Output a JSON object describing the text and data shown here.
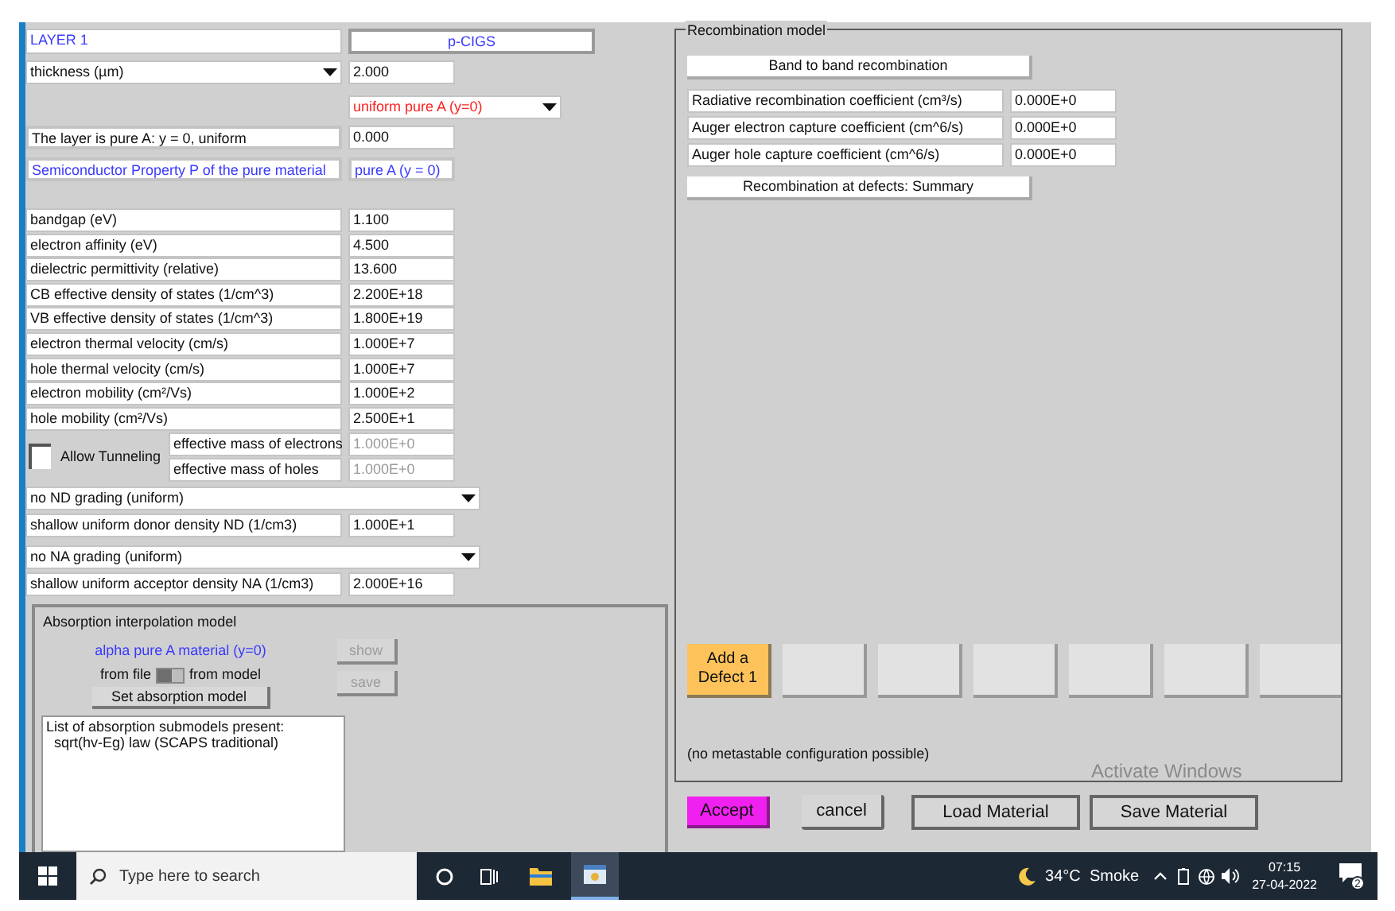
{
  "layer": {
    "title": "LAYER 1",
    "name": "p-CIGS"
  },
  "thickness": {
    "label": "thickness (µm)",
    "value": "2.000"
  },
  "grading": "uniform pure A (y=0)",
  "composition": {
    "label": "The layer is pure A: y = 0, uniform",
    "value": "0.000"
  },
  "property": {
    "label": "Semiconductor Property P of the pure material",
    "value": "pure A (y = 0)"
  },
  "parameters": [
    {
      "label": "bandgap (eV)",
      "value": "1.100"
    },
    {
      "label": "electron affinity (eV)",
      "value": "4.500"
    },
    {
      "label": "dielectric permittivity (relative)",
      "value": "13.600"
    },
    {
      "label": "CB effective density of states (1/cm^3)",
      "value": "2.200E+18"
    },
    {
      "label": "VB effective density of states (1/cm^3)",
      "value": "1.800E+19"
    },
    {
      "label": "electron thermal velocity (cm/s)",
      "value": "1.000E+7"
    },
    {
      "label": "hole thermal velocity (cm/s)",
      "value": "1.000E+7"
    },
    {
      "label": "electron mobility (cm²/Vs)",
      "value": "1.000E+2"
    },
    {
      "label": "hole mobility (cm²/Vs)",
      "value": "2.500E+1"
    }
  ],
  "tunneling": {
    "label": "Allow Tunneling",
    "checked": false,
    "rows": [
      {
        "label": "effective mass of electrons",
        "value": "1.000E+0",
        "disabled": true
      },
      {
        "label": "effective mass of holes",
        "value": "1.000E+0",
        "disabled": true
      }
    ]
  },
  "doping": [
    {
      "grading": "no ND grading (uniform)",
      "label": "shallow uniform donor density ND (1/cm3)",
      "value": "1.000E+1"
    },
    {
      "grading": "no NA grading (uniform)",
      "label": "shallow uniform acceptor density NA (1/cm3)",
      "value": "2.000E+16"
    }
  ],
  "absorption": {
    "title": "Absorption interpolation model",
    "material": "alpha pure A material (y=0)",
    "from_file": "from file",
    "from_model": "from model",
    "toggle_on": false,
    "set_button": "Set absorption model",
    "side_buttons": [
      {
        "label": "show",
        "disabled": true
      },
      {
        "label": "save",
        "disabled": true
      }
    ],
    "list_lines": [
      "List of absorption submodels present:",
      "  sqrt(hv-Eg) law (SCAPS traditional)"
    ]
  },
  "recombination": {
    "title": "Recombination model",
    "band_button": "Band to band recombination",
    "rows": [
      {
        "label": "Radiative recombination coefficient (cm³/s)",
        "value": "0.000E+0"
      },
      {
        "label": "Auger electron capture coefficient (cm^6/s)",
        "value": "0.000E+0"
      },
      {
        "label": "Auger hole capture coefficient (cm^6/s)",
        "value": "0.000E+0"
      }
    ],
    "defects_button": "Recombination at defects: Summary",
    "defect_slots": [
      {
        "kind": "add",
        "label": "Add a Defect 1"
      },
      {
        "kind": "empty"
      },
      {
        "kind": "empty"
      },
      {
        "kind": "empty"
      },
      {
        "kind": "empty"
      },
      {
        "kind": "empty"
      },
      {
        "kind": "empty"
      }
    ],
    "note": "(no metastable configuration possible)"
  },
  "activation_notice": "Activate Windows",
  "buttons": [
    {
      "kind": "accept",
      "label": "Accept"
    },
    {
      "kind": "plain",
      "label": "cancel"
    },
    {
      "kind": "wide",
      "label": "Load Material"
    },
    {
      "kind": "wide",
      "label": "Save Material"
    }
  ],
  "taskbar": {
    "search_placeholder": "Type here to search",
    "weather": "34°C  Smoke",
    "time": "07:15",
    "date": "27-04-2022",
    "notifications": "2"
  }
}
